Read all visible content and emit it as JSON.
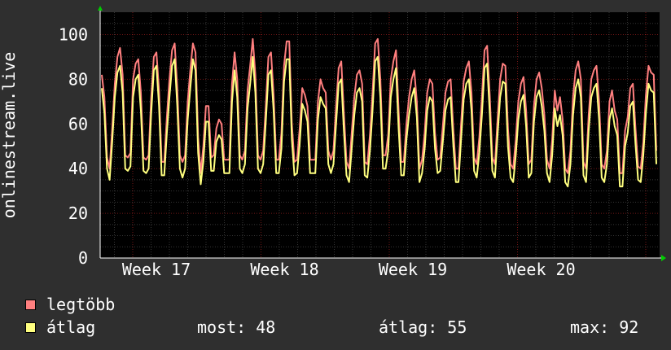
{
  "chart_data": {
    "type": "line",
    "ylabel": "onlinestream.live",
    "ylim": [
      0,
      110
    ],
    "yticks": [
      0,
      20,
      40,
      60,
      80,
      100
    ],
    "x_tick_labels": [
      "Week 17",
      "Week 18",
      "Week 19",
      "Week 20"
    ],
    "grid": true,
    "series": [
      {
        "name": "legtöbb",
        "color": "#ff7f7f",
        "values": [
          82,
          72,
          45,
          40,
          58,
          78,
          90,
          94,
          82,
          46,
          45,
          47,
          80,
          87,
          89,
          74,
          45,
          44,
          46,
          72,
          90,
          92,
          75,
          43,
          43,
          63,
          80,
          93,
          96,
          76,
          46,
          43,
          46,
          70,
          84,
          96,
          92,
          54,
          38,
          50,
          68,
          68,
          45,
          46,
          58,
          62,
          60,
          44,
          44,
          44,
          78,
          92,
          80,
          46,
          44,
          48,
          75,
          86,
          98,
          82,
          46,
          44,
          48,
          68,
          90,
          92,
          73,
          44,
          44,
          56,
          86,
          97,
          97,
          60,
          43,
          44,
          58,
          76,
          73,
          68,
          44,
          44,
          44,
          70,
          80,
          76,
          74,
          48,
          44,
          48,
          68,
          85,
          88,
          65,
          43,
          40,
          56,
          72,
          82,
          84,
          78,
          43,
          42,
          55,
          74,
          96,
          98,
          80,
          46,
          46,
          55,
          80,
          88,
          93,
          66,
          43,
          43,
          60,
          72,
          80,
          84,
          70,
          40,
          44,
          56,
          74,
          80,
          78,
          56,
          44,
          45,
          59,
          74,
          79,
          80,
          58,
          40,
          40,
          60,
          79,
          85,
          88,
          74,
          45,
          42,
          54,
          72,
          93,
          95,
          73,
          45,
          42,
          62,
          80,
          87,
          86,
          58,
          42,
          40,
          53,
          70,
          78,
          81,
          66,
          42,
          44,
          68,
          80,
          83,
          76,
          64,
          44,
          40,
          53,
          75,
          66,
          72,
          62,
          40,
          38,
          48,
          72,
          84,
          88,
          80,
          43,
          40,
          64,
          80,
          84,
          86,
          70,
          42,
          40,
          48,
          70,
          75,
          66,
          62,
          38,
          38,
          57,
          63,
          76,
          78,
          58,
          41,
          40,
          52,
          73,
          86,
          83,
          82,
          48
        ]
      },
      {
        "name": "átlag",
        "color": "#ffff7f",
        "values": [
          76,
          65,
          40,
          35,
          52,
          72,
          83,
          86,
          74,
          40,
          39,
          41,
          72,
          80,
          82,
          66,
          39,
          38,
          40,
          65,
          84,
          86,
          68,
          37,
          37,
          56,
          72,
          86,
          89,
          68,
          40,
          36,
          40,
          62,
          76,
          89,
          84,
          47,
          33,
          43,
          61,
          61,
          39,
          39,
          52,
          55,
          53,
          38,
          38,
          38,
          70,
          84,
          72,
          40,
          38,
          42,
          67,
          78,
          90,
          74,
          40,
          38,
          42,
          61,
          82,
          84,
          66,
          38,
          38,
          49,
          79,
          89,
          89,
          53,
          37,
          38,
          51,
          69,
          66,
          61,
          38,
          38,
          38,
          62,
          72,
          69,
          67,
          42,
          38,
          42,
          60,
          78,
          80,
          57,
          37,
          34,
          49,
          64,
          74,
          76,
          70,
          37,
          36,
          48,
          66,
          88,
          90,
          72,
          40,
          40,
          48,
          72,
          80,
          85,
          58,
          37,
          37,
          53,
          64,
          72,
          76,
          63,
          34,
          38,
          49,
          66,
          72,
          70,
          49,
          38,
          39,
          52,
          66,
          71,
          72,
          51,
          34,
          34,
          53,
          71,
          78,
          80,
          66,
          39,
          36,
          47,
          64,
          85,
          87,
          65,
          39,
          36,
          55,
          72,
          79,
          78,
          50,
          36,
          34,
          46,
          62,
          70,
          73,
          59,
          36,
          38,
          61,
          72,
          75,
          68,
          57,
          38,
          34,
          46,
          67,
          59,
          64,
          55,
          34,
          32,
          42,
          64,
          76,
          80,
          72,
          37,
          34,
          57,
          72,
          76,
          78,
          62,
          36,
          34,
          42,
          62,
          67,
          59,
          55,
          32,
          32,
          50,
          56,
          68,
          70,
          51,
          35,
          34,
          46,
          65,
          78,
          75,
          74,
          42
        ]
      }
    ]
  },
  "legend": {
    "max_label": "legtöbb",
    "avg_label": "átlag",
    "max_color": "#ff7f7f",
    "avg_color": "#ffff7f",
    "now_text": "most: 48",
    "average_text": "átlag: 55",
    "max_text": "max: 92"
  }
}
